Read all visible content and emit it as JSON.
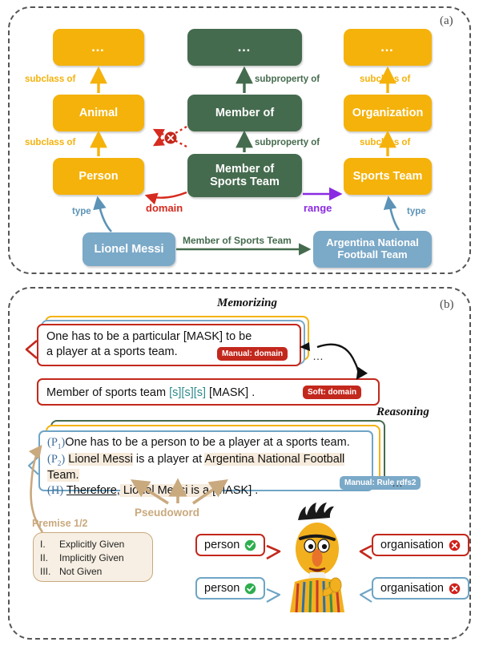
{
  "figure": {
    "panel_a_tag": "(a)",
    "panel_b_tag": "(b)"
  },
  "panel_a": {
    "nodes": {
      "dots_left": "…",
      "animal": "Animal",
      "person": "Person",
      "dots_mid": "…",
      "member_of": "Member of",
      "member_of_sports_team": "Member of\nSports Team",
      "dots_right": "…",
      "organization": "Organization",
      "sports_team": "Sports Team",
      "lionel_messi": "Lionel Messi",
      "argentina": "Argentina National\nFootball Team"
    },
    "edges": {
      "subclass_of_1": "subclass of",
      "subclass_of_2": "subclass of",
      "subproperty_of_1": "subproperty of",
      "subproperty_of_2": "subproperty of",
      "subclass_of_3": "subclass of",
      "subclass_of_4": "subclass of",
      "type_left": "type",
      "type_right": "type",
      "domain": "domain",
      "range": "range",
      "relation": "Member of Sports Team"
    },
    "colors": {
      "class_box": "#F4B20B",
      "property_box": "#456B4E",
      "instance_box": "#7BA9C8",
      "domain": "#D62B1F",
      "range": "#8A2BE2",
      "type": "#5C93B6",
      "conflict_marker": "#C3281C"
    }
  },
  "panel_b": {
    "memorizing_title": "Memorizing",
    "reasoning_title": "Reasoning",
    "ellipsis_1": "…",
    "ellipsis_2": "…",
    "manual_card": {
      "line1": "One has to be a particular [MASK] to be",
      "line2": "a player at a sports team.",
      "badge": "Manual: domain"
    },
    "soft_card": {
      "text_pre": "Member of sports team ",
      "pseudowords": "[s][s][s]",
      "text_post": " [MASK] .",
      "badge": "Soft: domain"
    },
    "reasoning_card": {
      "p1_prefix": "(P",
      "p1_sub": "1",
      "p1_suffix": ")",
      "p1_text_a": "One has to be a ",
      "p1_text_hl": "person",
      "p1_text_b": " to be a player at a sports team.",
      "p2_prefix": "(P",
      "p2_sub": "2",
      "p2_suffix": ")",
      "p2_hl1": "Lionel Messi",
      "p2_mid": " is a player at ",
      "p2_hl2": "Argentina National Football Team.",
      "h_prefix": "(H)",
      "h_therefore": "Therefore,",
      "h_hl": " Lionel Messi is a ",
      "h_rest": "[MASK] .",
      "badge": "Manual: Rule rdfs2"
    },
    "pseudoword_caption": "Pseudoword",
    "premise_caption": "Premise 1/2",
    "premise_options": [
      {
        "numeral": "I.",
        "label": "Explicitly Given"
      },
      {
        "numeral": "II.",
        "label": "Implicitly Given"
      },
      {
        "numeral": "III.",
        "label": "Not Given"
      }
    ],
    "predictions": [
      {
        "text": "person",
        "mark": "check-icon",
        "style": "red",
        "side": "left"
      },
      {
        "text": "organisation",
        "mark": "cross-icon",
        "style": "red",
        "side": "right"
      },
      {
        "text": "person",
        "mark": "check-icon",
        "style": "blue",
        "side": "left"
      },
      {
        "text": "organisation",
        "mark": "cross-icon",
        "style": "blue",
        "side": "right"
      }
    ],
    "colors": {
      "manual_border": "#C3281C",
      "soft_border": "#C3281C",
      "reasoning_border": "#6FA5C6",
      "pseudoword": "#C9A97E",
      "pseudoword_text": "#2E8B8B",
      "highlight": "#F6EBDC",
      "check": "#2EAE4E",
      "cross": "#D0211C"
    }
  }
}
